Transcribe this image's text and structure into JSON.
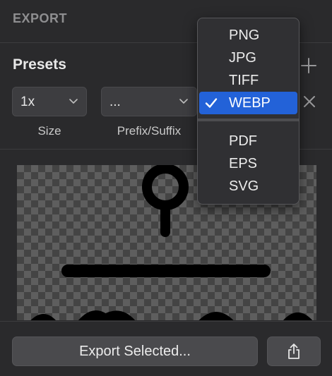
{
  "panel": {
    "section_title": "EXPORT",
    "presets_label": "Presets"
  },
  "icons": {
    "add": "plus-icon",
    "remove": "close-icon",
    "chevron": "chevron-down-icon",
    "checkmark": "checkmark-icon",
    "share": "share-icon"
  },
  "preset": {
    "size_value": "1x",
    "size_caption": "Size",
    "prefix_value": "...",
    "prefix_caption": "Prefix/Suffix"
  },
  "format_menu": {
    "group1": [
      "PNG",
      "JPG",
      "TIFF",
      "WEBP"
    ],
    "group2": [
      "PDF",
      "EPS",
      "SVG"
    ],
    "selected": "WEBP"
  },
  "footer": {
    "export_label": "Export Selected..."
  },
  "colors": {
    "accent": "#2362d8",
    "panel_bg": "#2a2a2c"
  }
}
